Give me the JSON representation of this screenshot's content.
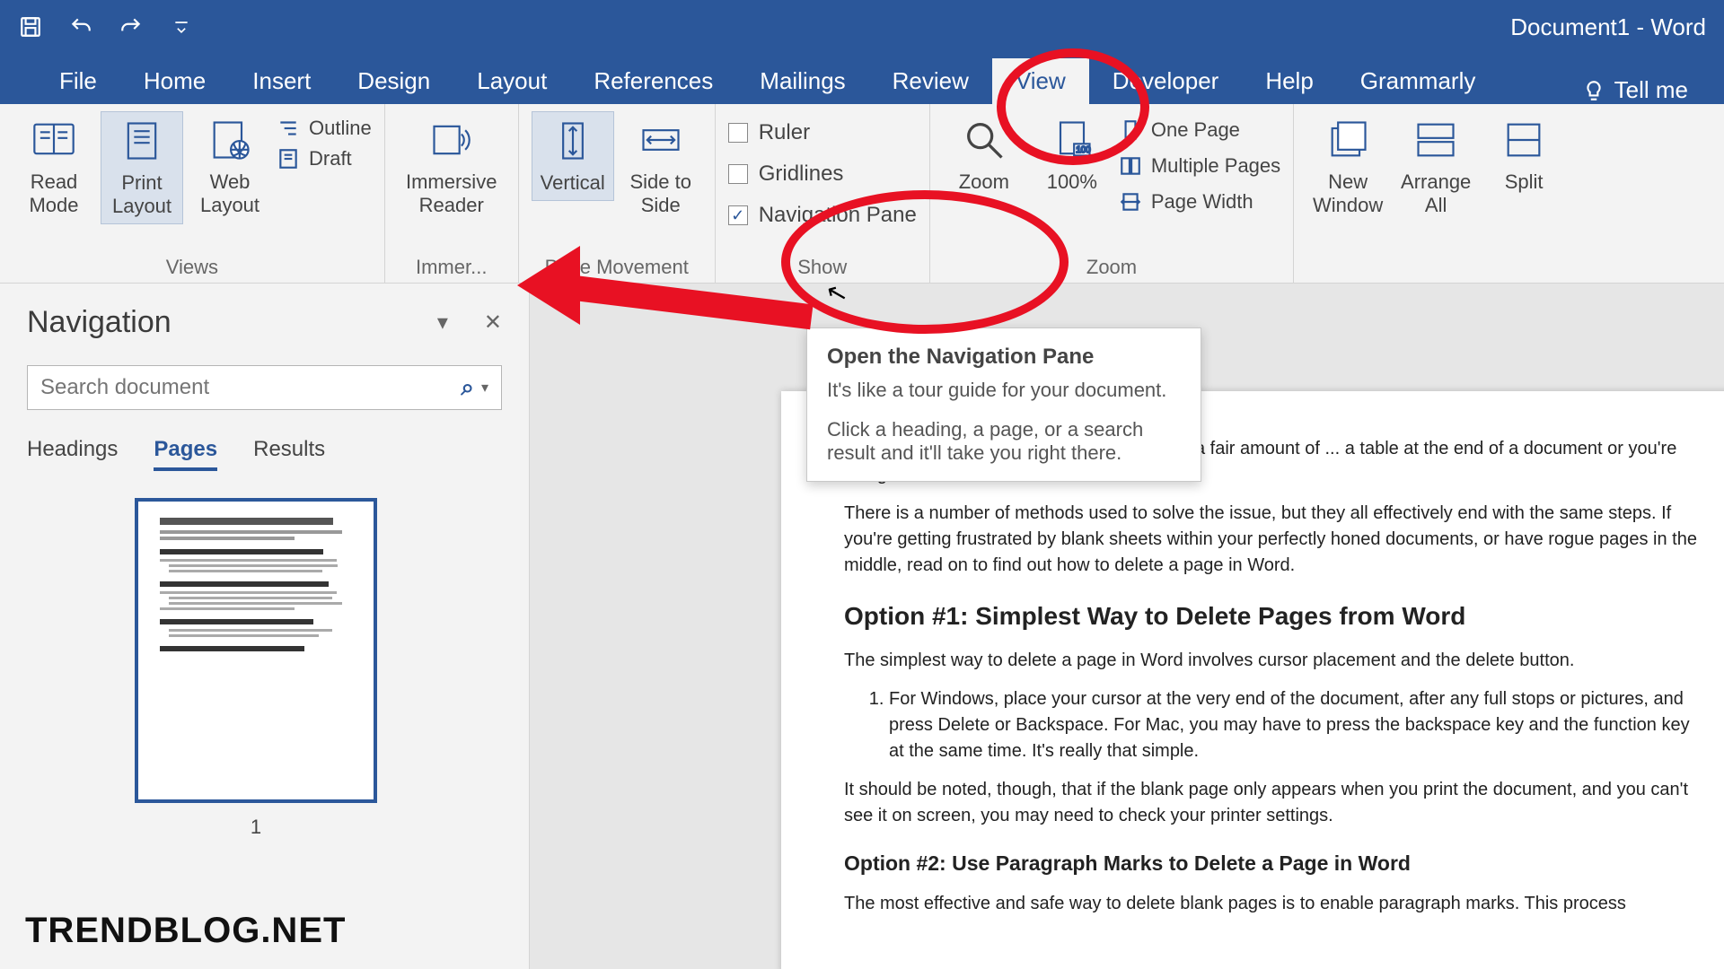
{
  "title": "Document1 - Word",
  "qat": {
    "save": "save-icon",
    "undo": "undo-icon",
    "redo": "redo-icon",
    "customize": "customize-icon"
  },
  "tabs": [
    "File",
    "Home",
    "Insert",
    "Design",
    "Layout",
    "References",
    "Mailings",
    "Review",
    "View",
    "Developer",
    "Help",
    "Grammarly"
  ],
  "active_tab": "View",
  "tellme": "Tell me",
  "ribbon": {
    "views": {
      "label": "Views",
      "read_mode": "Read Mode",
      "print_layout": "Print Layout",
      "web_layout": "Web Layout",
      "outline": "Outline",
      "draft": "Draft"
    },
    "immersive": {
      "label": "Immer...",
      "reader": "Immersive Reader"
    },
    "page_movement": {
      "label": "Page Movement",
      "vertical": "Vertical",
      "side": "Side to Side"
    },
    "show": {
      "label": "Show",
      "ruler": "Ruler",
      "gridlines": "Gridlines",
      "navigation": "Navigation Pane",
      "nav_checked": true
    },
    "zoom": {
      "label": "Zoom",
      "zoom": "Zoom",
      "hundred": "100%",
      "one_page": "One Page",
      "multiple": "Multiple Pages",
      "page_width": "Page Width"
    },
    "window": {
      "new_window": "New Window",
      "arrange_all": "Arrange All",
      "split": "Split"
    }
  },
  "tooltip": {
    "title": "Open the Navigation Pane",
    "line1": "It's like a tour guide for your document.",
    "line2": "Click a heading, a page, or a search result and it'll take you right there."
  },
  "navpane": {
    "title": "Navigation",
    "search_placeholder": "Search document",
    "tabs": {
      "headings": "Headings",
      "pages": "Pages",
      "results": "Results"
    },
    "active": "Pages",
    "thumb_label": "1"
  },
  "document": {
    "intro1": "...ete a page in Word, but it seems to cause a fair amount of ... a table at the end of a document or you're using Microsoft",
    "intro2": "There is a number of methods used to solve the issue, but they all effectively end with the same steps. If you're getting frustrated by blank sheets within your perfectly honed documents, or have rogue pages in the middle, read on to find out how to delete a page in Word.",
    "h1": "Option #1: Simplest Way to Delete Pages from Word",
    "p1": "The simplest way to delete a page in Word involves cursor placement and the delete button.",
    "li1": "For Windows, place your cursor at the very end of the document, after any full stops or pictures, and press Delete or Backspace. For Mac, you may have to press the backspace key and the function key at the same time. It's really that simple.",
    "p2": "It should be noted, though, that if the blank page only appears when you print the document, and you can't see it on screen, you may need to check your printer settings.",
    "h2": "Option #2: Use Paragraph Marks to Delete a Page in Word",
    "p3": "The most effective and safe way to delete blank pages is to enable paragraph marks. This process"
  },
  "watermark": "TRENDBLOG.NET"
}
